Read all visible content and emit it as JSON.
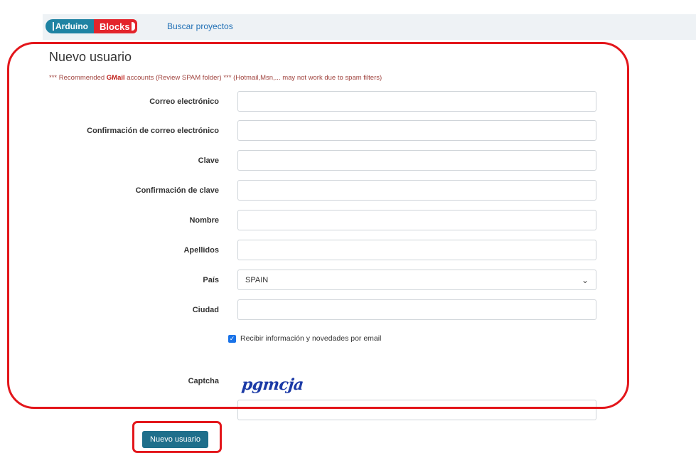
{
  "navbar": {
    "logo_left": "Arduino",
    "logo_right": "Blocks",
    "search_link": "Buscar proyectos"
  },
  "page": {
    "title": "Nuevo usuario",
    "notice_prefix": "*** Recommended ",
    "notice_brand": "GMail",
    "notice_suffix": " accounts (Review SPAM folder) *** (Hotmail,Msn,... may not work due to spam filters)"
  },
  "form": {
    "email_label": "Correo electrónico",
    "email_value": "",
    "email_confirm_label": "Confirmación de correo electrónico",
    "email_confirm_value": "",
    "password_label": "Clave",
    "password_value": "",
    "password_confirm_label": "Confirmación de clave",
    "password_confirm_value": "",
    "name_label": "Nombre",
    "name_value": "",
    "surname_label": "Apellidos",
    "surname_value": "",
    "country_label": "País",
    "country_value": "SPAIN",
    "city_label": "Ciudad",
    "city_value": "",
    "newsletter_label": "Recibir información y novedades por email",
    "newsletter_checked": true,
    "captcha_label": "Captcha",
    "captcha_text": "pgmcja",
    "captcha_value": "",
    "submit_label": "Nuevo usuario"
  },
  "colors": {
    "highlight": "#e3161b",
    "button": "#1f6f8b",
    "link": "#1f6fb5",
    "notice": "#a0443f"
  }
}
